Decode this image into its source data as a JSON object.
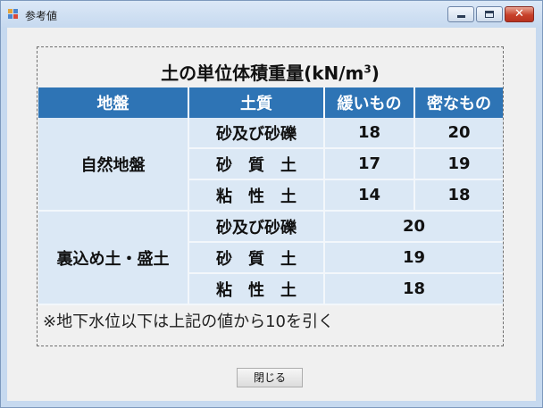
{
  "window": {
    "title": "参考値",
    "close_glyph": "✕"
  },
  "table": {
    "title": "土の単位体積重量(kN/m",
    "title_sup": "3",
    "title_tail": ")",
    "headers": [
      "地盤",
      "土質",
      "緩いもの",
      "密なもの"
    ],
    "groups": [
      {
        "ground": "自然地盤",
        "rows": [
          {
            "soil": "砂及び砂礫",
            "loose": "18",
            "dense": "20"
          },
          {
            "soil": "砂　質　土",
            "loose": "17",
            "dense": "19"
          },
          {
            "soil": "粘　性　土",
            "loose": "14",
            "dense": "18"
          }
        ]
      },
      {
        "ground": "裏込め土・盛土",
        "rows": [
          {
            "soil": "砂及び砂礫",
            "value": "20"
          },
          {
            "soil": "砂　質　土",
            "value": "19"
          },
          {
            "soil": "粘　性　土",
            "value": "18"
          }
        ]
      }
    ],
    "note": "※地下水位以下は上記の値から10を引く"
  },
  "footer": {
    "close_label": "閉じる"
  },
  "colors": {
    "header_bg": "#2e74b5",
    "cell_bg": "#dbe8f5",
    "client_bg": "#f0f0f0"
  }
}
